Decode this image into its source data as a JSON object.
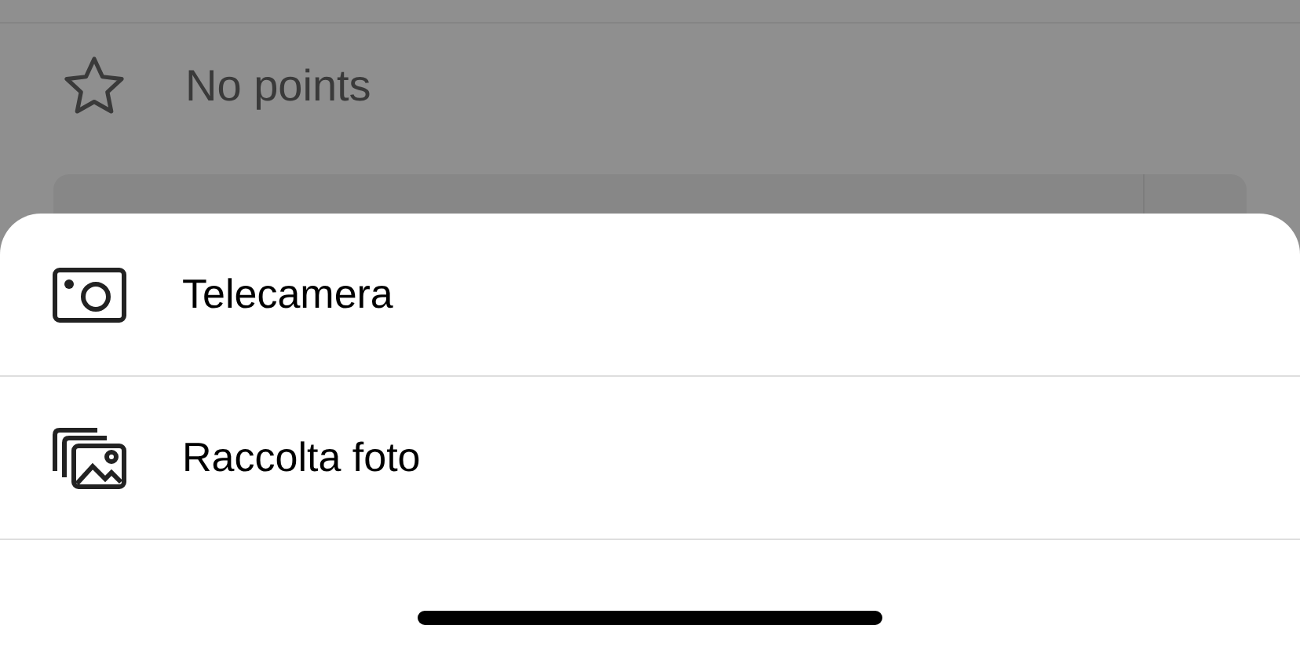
{
  "background": {
    "points_label": "No points"
  },
  "sheet": {
    "options": [
      {
        "kind": "camera",
        "label": "Telecamera"
      },
      {
        "kind": "library",
        "label": "Raccolta foto"
      }
    ]
  }
}
